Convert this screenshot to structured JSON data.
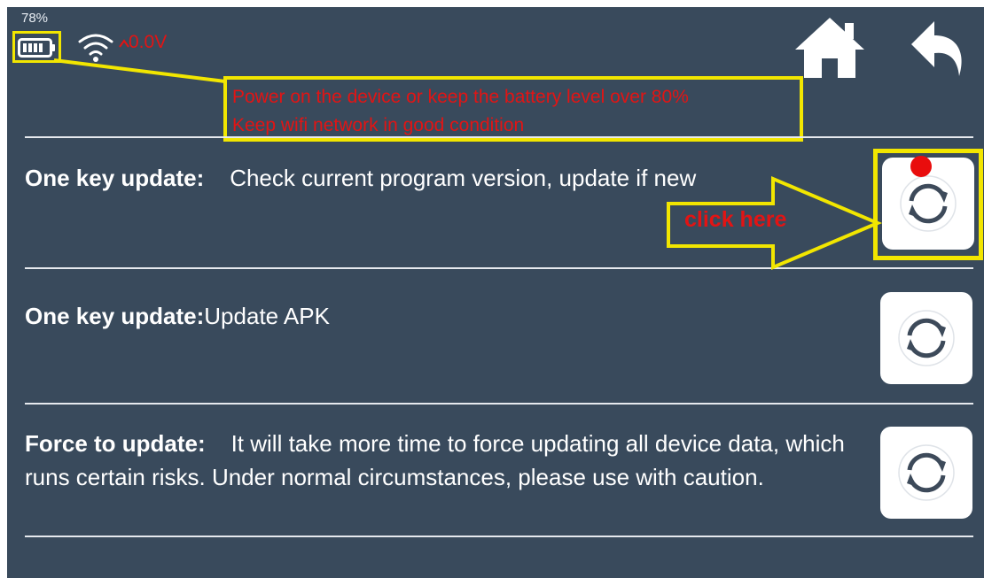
{
  "status_bar": {
    "battery_percent": "78%",
    "voltage": "0.0V",
    "icons": [
      "battery-icon",
      "wifi-icon",
      "voltage-icon",
      "home-icon",
      "back-icon"
    ]
  },
  "callout": {
    "tip_line_1": "Power on the device or keep the battery level over 80%",
    "tip_line_2": "Keep wifi network in good condition",
    "click_label": "click here"
  },
  "rows": [
    {
      "title": "One key update:",
      "description": "Check current program version, update if new",
      "button_icon": "sync-icon"
    },
    {
      "title": "One key update:",
      "description": "Update APK",
      "button_icon": "sync-icon"
    },
    {
      "title": "Force to update:",
      "description": "It will take more time to force updating all device data, which runs certain risks. Under normal circumstances, please use with caution.",
      "button_icon": "sync-icon"
    }
  ],
  "colors": {
    "background": "#394a5c",
    "annotation_yellow": "#f2e600",
    "annotation_red": "#e21414",
    "divider": "#e6e9ee"
  }
}
